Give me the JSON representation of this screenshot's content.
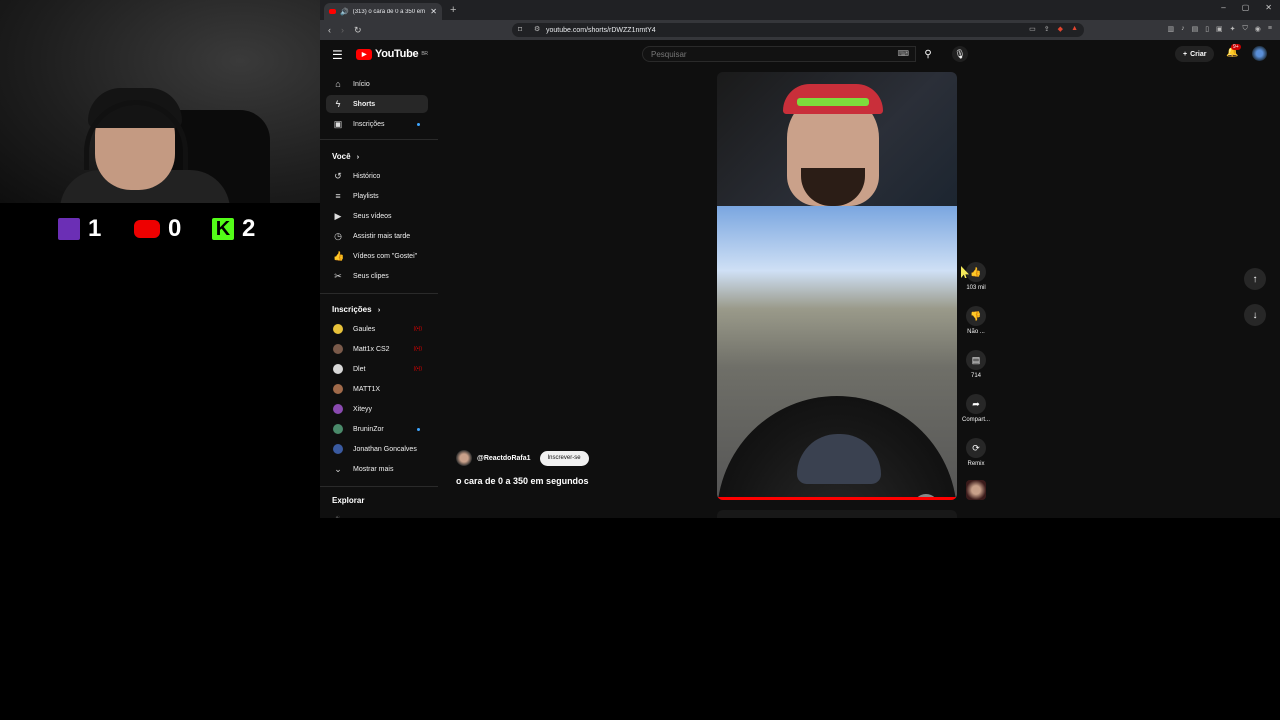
{
  "scoreboard": {
    "twitch_score": "1",
    "youtube_score": "0",
    "kick_score": "2",
    "kick_letter": "K"
  },
  "browser": {
    "tab_title": "(313) o cara de 0 a 350 em se...",
    "url": "youtube.com/shorts/rDWZZ1nmtY4",
    "window_controls": [
      "–",
      "▢",
      "✕"
    ]
  },
  "youtube": {
    "logo_text": "YouTube",
    "logo_region": "BR",
    "search_placeholder": "Pesquisar",
    "create_label": "Criar",
    "notif_badge": "9+"
  },
  "sidebar": {
    "main": [
      {
        "label": "Início",
        "icon": "home-icon"
      },
      {
        "label": "Shorts",
        "icon": "shorts-icon"
      },
      {
        "label": "Inscrições",
        "icon": "subscriptions-icon"
      }
    ],
    "you_header": "Você",
    "you_items": [
      {
        "label": "Histórico",
        "icon": "history-icon"
      },
      {
        "label": "Playlists",
        "icon": "playlists-icon"
      },
      {
        "label": "Seus vídeos",
        "icon": "your-videos-icon"
      },
      {
        "label": "Assistir mais tarde",
        "icon": "watch-later-icon"
      },
      {
        "label": "Vídeos com \"Gostei\"",
        "icon": "liked-icon"
      },
      {
        "label": "Seus clipes",
        "icon": "clips-icon"
      }
    ],
    "subs_header": "Inscrições",
    "subs": [
      {
        "label": "Gaules",
        "color": "#e8c23a"
      },
      {
        "label": "Matt1x CS2",
        "color": "#7a5a4a"
      },
      {
        "label": "Dlet",
        "color": "#d8d8d8"
      },
      {
        "label": "MATT1X",
        "color": "#a06a4a"
      },
      {
        "label": "Xiteyy",
        "color": "#8a4ab0"
      },
      {
        "label": "BruninZor",
        "color": "#4a8a6a"
      },
      {
        "label": "Jonathan Goncalves",
        "color": "#3a5aa0"
      }
    ],
    "show_more": "Mostrar mais",
    "explore_header": "Explorar"
  },
  "short": {
    "channel": "@ReactdoRafa1",
    "subscribe_label": "Inscrever-se",
    "title": "o cara de 0 a 350 em segundos",
    "likes": "103 mil",
    "dislike_label": "Não ...",
    "comments": "714",
    "share_label": "Compart...",
    "remix_label": "Remix",
    "progress": 1.0
  }
}
